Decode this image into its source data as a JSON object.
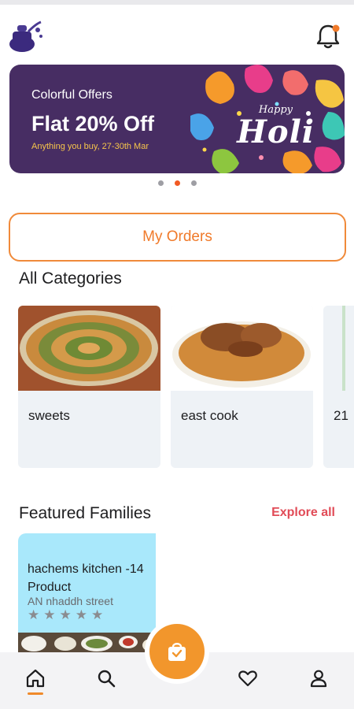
{
  "header": {
    "logo_icon": "kitchen-logo-icon",
    "notification_icon": "bell-icon",
    "notification_badge_color": "#f07a2a"
  },
  "banner": {
    "kicker": "Colorful Offers",
    "headline": "Flat 20% Off",
    "subtext": "Anything you buy, 27-30th Mar",
    "art_happy": "Happy",
    "art_word": "Holi",
    "slide_count": 3,
    "active_slide": 2
  },
  "orders": {
    "label": "My Orders"
  },
  "categories": {
    "title": "All Categories",
    "items": [
      {
        "label": "sweets"
      },
      {
        "label": "east cook"
      },
      {
        "label": "21"
      }
    ]
  },
  "families": {
    "title": "Featured Families",
    "explore_label": "Explore all",
    "items": [
      {
        "name": "hachems kitchen -14 Product",
        "location": "AN nhaddh street",
        "rating": 0,
        "rating_max": 5
      }
    ]
  },
  "nav": {
    "items": [
      "home-icon",
      "search-icon",
      "cart-icon",
      "heart-icon",
      "person-icon"
    ],
    "active": "home-icon"
  },
  "colors": {
    "accent": "#f2962c",
    "banner_bg": "#472d63",
    "explore": "#e14b57"
  }
}
